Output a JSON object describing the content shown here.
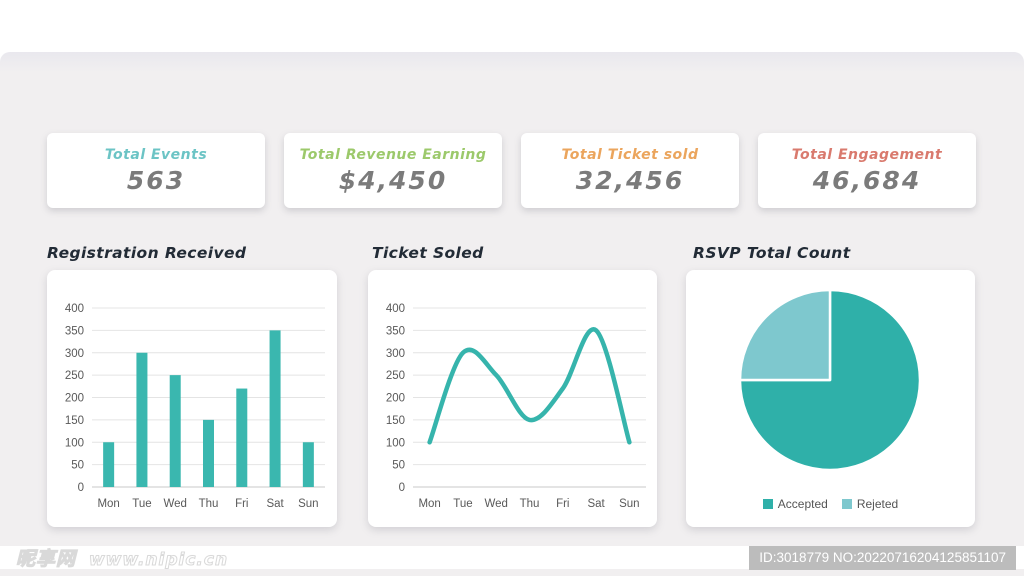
{
  "stats": {
    "cards": [
      {
        "label": "Total Events",
        "value": "563",
        "color": "#6cc4c5"
      },
      {
        "label": "Total Revenue Earning",
        "value": "$4,450",
        "color": "#9cc96b"
      },
      {
        "label": "Total Ticket sold",
        "value": "32,456",
        "color": "#eba55d"
      },
      {
        "label": "Total Engagement",
        "value": "46,684",
        "color": "#d97a6e"
      }
    ]
  },
  "chart_data": [
    {
      "type": "bar",
      "title": "Registration Received",
      "categories": [
        "Mon",
        "Tue",
        "Wed",
        "Thu",
        "Fri",
        "Sat",
        "Sun"
      ],
      "values": [
        100,
        300,
        250,
        150,
        220,
        350,
        100
      ],
      "xlabel": "",
      "ylabel": "",
      "ylim": [
        0,
        400
      ],
      "ytick_step": 50,
      "grid": true,
      "color": "#3ab7af"
    },
    {
      "type": "line",
      "title": "Ticket Soled",
      "categories": [
        "Mon",
        "Tue",
        "Wed",
        "Thu",
        "Fri",
        "Sat",
        "Sun"
      ],
      "values": [
        100,
        300,
        250,
        150,
        220,
        350,
        100
      ],
      "xlabel": "",
      "ylabel": "",
      "ylim": [
        0,
        400
      ],
      "ytick_step": 50,
      "grid": true,
      "smooth": true,
      "color": "#36b4ac"
    },
    {
      "type": "pie",
      "title": "RSVP Total Count",
      "slices": [
        {
          "label": "Accepted",
          "value": 75,
          "color": "#2fb0a9"
        },
        {
          "label": "Rejeted",
          "value": 25,
          "color": "#7ec8ce"
        }
      ],
      "start_angle_deg": -90,
      "legend_position": "bottom"
    }
  ],
  "axis_style": {
    "tick_color": "#595959",
    "grid_color": "#e4e4e4",
    "baseline_color": "#c8c8c8"
  },
  "watermark": {
    "site_name": "昵享网",
    "site_url": "www.nipic.cn",
    "id_label": "ID:3018779 NO:20220716204125851107"
  }
}
